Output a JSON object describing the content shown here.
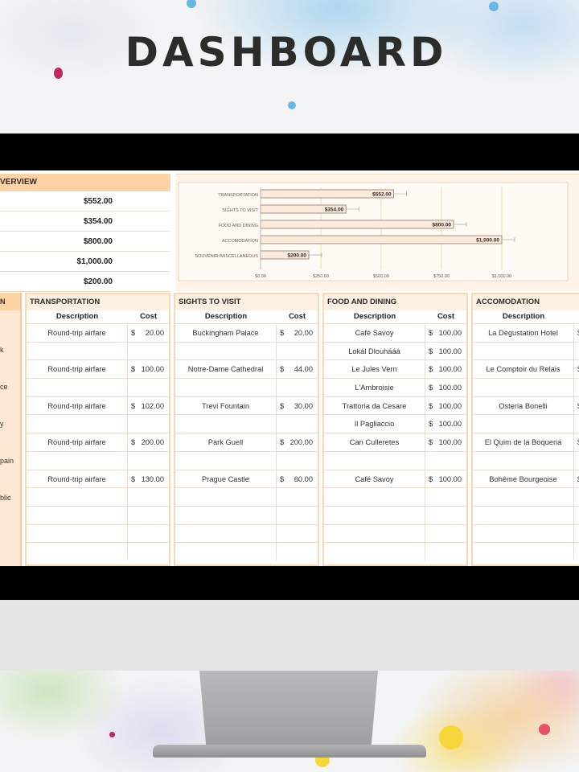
{
  "title": "DASHBOARD",
  "overview": {
    "header": "VERVIEW",
    "values": [
      "$552.00",
      "$354.00",
      "$800.00",
      "$1,000.00",
      "$200.00"
    ]
  },
  "left_strip": {
    "header": "N",
    "fragments": [
      "k",
      "ce",
      "y",
      "pain",
      "blic"
    ]
  },
  "chart_data": {
    "type": "bar",
    "orientation": "horizontal",
    "categories": [
      "TRANSPORTATION",
      "SIGHTS TO VISIT",
      "FOOD AND DINING",
      "ACCOMODATION",
      "SOUVENIR /MISCELLANEOUS"
    ],
    "values": [
      552,
      354,
      800,
      1000,
      200
    ],
    "data_labels": [
      "$552.00",
      "$354.00",
      "$800.00",
      "$1,000.00",
      "$200.00"
    ],
    "xlim": [
      0,
      1000
    ],
    "x_ticks": [
      "$0.00",
      "$250.00",
      "$500.00",
      "$750.00",
      "$1,000.00"
    ],
    "error_bars": true,
    "grid": true,
    "colors": {
      "bar_fill": "#fdeadb",
      "bar_stroke": "#8a7a6e",
      "grid": "#e9dcb8"
    }
  },
  "panels": [
    {
      "title": "TRANSPORTATION",
      "desc_header": "Description",
      "cost_header": "Cost",
      "rows": [
        {
          "desc": "Round-trip airfare",
          "cur": "$",
          "amt": "20.00"
        },
        {
          "desc": "",
          "cur": "",
          "amt": ""
        },
        {
          "desc": "Round-trip airfare",
          "cur": "$",
          "amt": "100.00"
        },
        {
          "desc": "",
          "cur": "",
          "amt": ""
        },
        {
          "desc": "Round-trip airfare",
          "cur": "$",
          "amt": "102.00"
        },
        {
          "desc": "",
          "cur": "",
          "amt": ""
        },
        {
          "desc": "Round-trip airfare",
          "cur": "$",
          "amt": "200.00"
        },
        {
          "desc": "",
          "cur": "",
          "amt": ""
        },
        {
          "desc": "Round-trip airfare",
          "cur": "$",
          "amt": "130.00"
        },
        {
          "desc": "",
          "cur": "",
          "amt": ""
        },
        {
          "desc": "",
          "cur": "",
          "amt": ""
        },
        {
          "desc": "",
          "cur": "",
          "amt": ""
        },
        {
          "desc": "",
          "cur": "",
          "amt": ""
        }
      ]
    },
    {
      "title": "SIGHTS TO VISIT",
      "desc_header": "Description",
      "cost_header": "Cost",
      "rows": [
        {
          "desc": "Buckingham Palace",
          "cur": "$",
          "amt": "20.00"
        },
        {
          "desc": "",
          "cur": "",
          "amt": ""
        },
        {
          "desc": "Notre-Dame Cathedral",
          "cur": "$",
          "amt": "44.00"
        },
        {
          "desc": "",
          "cur": "",
          "amt": ""
        },
        {
          "desc": "Trevi Fountain",
          "cur": "$",
          "amt": "30.00"
        },
        {
          "desc": "",
          "cur": "",
          "amt": ""
        },
        {
          "desc": "Park Guell",
          "cur": "$",
          "amt": "200.00"
        },
        {
          "desc": "",
          "cur": "",
          "amt": ""
        },
        {
          "desc": "Prague Castle",
          "cur": "$",
          "amt": "60.00"
        },
        {
          "desc": "",
          "cur": "",
          "amt": ""
        },
        {
          "desc": "",
          "cur": "",
          "amt": ""
        },
        {
          "desc": "",
          "cur": "",
          "amt": ""
        },
        {
          "desc": "",
          "cur": "",
          "amt": ""
        }
      ]
    },
    {
      "title": "FOOD AND DINING",
      "desc_header": "Description",
      "cost_header": "Cost",
      "rows": [
        {
          "desc": "Café Savoy",
          "cur": "$",
          "amt": "100.00"
        },
        {
          "desc": "Lokál Dlouhááá",
          "cur": "$",
          "amt": "100.00"
        },
        {
          "desc": "Le Jules Vern",
          "cur": "$",
          "amt": "100.00"
        },
        {
          "desc": "L'Ambroisie",
          "cur": "$",
          "amt": "100.00"
        },
        {
          "desc": "Trattoria da Cesare",
          "cur": "$",
          "amt": "100.00"
        },
        {
          "desc": "Il Pagliaccio",
          "cur": "$",
          "amt": "100.00"
        },
        {
          "desc": "Can Culleretes",
          "cur": "$",
          "amt": "100.00"
        },
        {
          "desc": "",
          "cur": "",
          "amt": ""
        },
        {
          "desc": "Café Savoy",
          "cur": "$",
          "amt": "100.00"
        },
        {
          "desc": "",
          "cur": "",
          "amt": ""
        },
        {
          "desc": "",
          "cur": "",
          "amt": ""
        },
        {
          "desc": "",
          "cur": "",
          "amt": ""
        },
        {
          "desc": "",
          "cur": "",
          "amt": ""
        }
      ]
    },
    {
      "title": "ACCOMODATION",
      "desc_header": "Description",
      "cost_header": "",
      "rows": [
        {
          "desc": "La Degustation Hotel",
          "cur": "$",
          "amt": ""
        },
        {
          "desc": "",
          "cur": "",
          "amt": ""
        },
        {
          "desc": "Le Comptoir du Relais",
          "cur": "$",
          "amt": ""
        },
        {
          "desc": "",
          "cur": "",
          "amt": ""
        },
        {
          "desc": "Osteria Bonelli",
          "cur": "$",
          "amt": ""
        },
        {
          "desc": "",
          "cur": "",
          "amt": ""
        },
        {
          "desc": "El Quim de la Boqueria",
          "cur": "$",
          "amt": ""
        },
        {
          "desc": "",
          "cur": "",
          "amt": ""
        },
        {
          "desc": "Bohême Bourgeoise",
          "cur": "$",
          "amt": ""
        },
        {
          "desc": "",
          "cur": "",
          "amt": ""
        },
        {
          "desc": "",
          "cur": "",
          "amt": ""
        },
        {
          "desc": "",
          "cur": "",
          "amt": ""
        },
        {
          "desc": "",
          "cur": "",
          "amt": ""
        }
      ]
    }
  ]
}
